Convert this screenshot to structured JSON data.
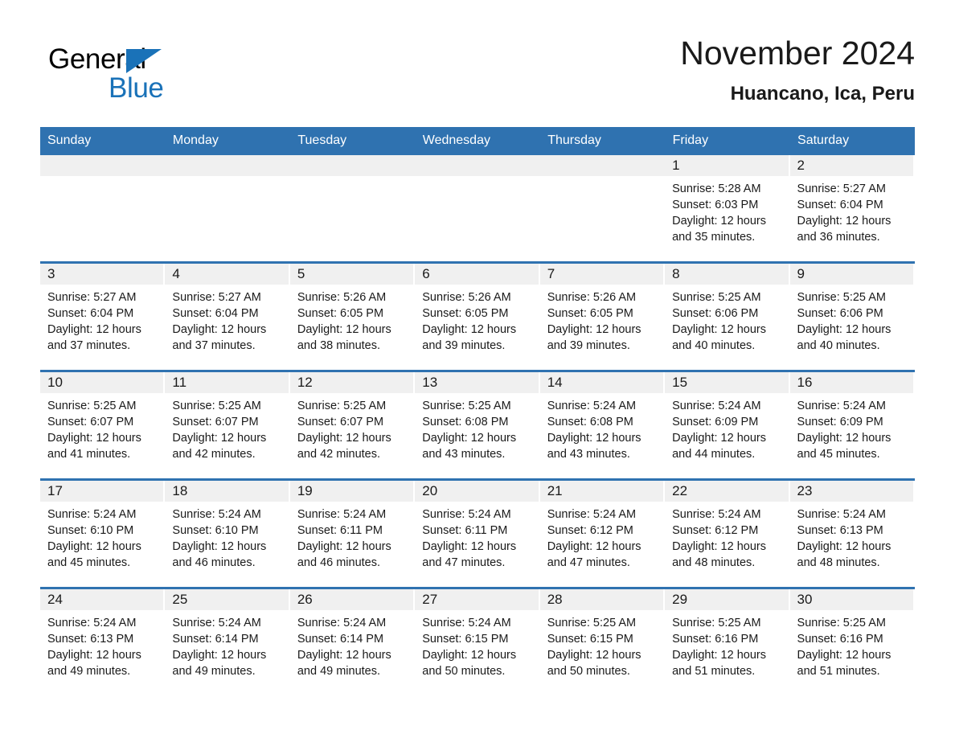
{
  "brand": {
    "name_part1": "General",
    "name_part2": "Blue",
    "accent_color": "#1a72b8"
  },
  "header": {
    "month_title": "November 2024",
    "location": "Huancano, Ica, Peru"
  },
  "theme": {
    "header_blue": "#2f72b0",
    "daynum_gray": "#f0f0f0",
    "text_color": "#1a1a1a"
  },
  "weekday_headers": [
    "Sunday",
    "Monday",
    "Tuesday",
    "Wednesday",
    "Thursday",
    "Friday",
    "Saturday"
  ],
  "labels": {
    "sunrise_prefix": "Sunrise:",
    "sunset_prefix": "Sunset:",
    "daylight_prefix": "Daylight:"
  },
  "weeks": [
    [
      {
        "day": "",
        "sunrise": "",
        "sunset": "",
        "daylight": ""
      },
      {
        "day": "",
        "sunrise": "",
        "sunset": "",
        "daylight": ""
      },
      {
        "day": "",
        "sunrise": "",
        "sunset": "",
        "daylight": ""
      },
      {
        "day": "",
        "sunrise": "",
        "sunset": "",
        "daylight": ""
      },
      {
        "day": "",
        "sunrise": "",
        "sunset": "",
        "daylight": ""
      },
      {
        "day": "1",
        "sunrise": "Sunrise: 5:28 AM",
        "sunset": "Sunset: 6:03 PM",
        "daylight": "Daylight: 12 hours and 35 minutes."
      },
      {
        "day": "2",
        "sunrise": "Sunrise: 5:27 AM",
        "sunset": "Sunset: 6:04 PM",
        "daylight": "Daylight: 12 hours and 36 minutes."
      }
    ],
    [
      {
        "day": "3",
        "sunrise": "Sunrise: 5:27 AM",
        "sunset": "Sunset: 6:04 PM",
        "daylight": "Daylight: 12 hours and 37 minutes."
      },
      {
        "day": "4",
        "sunrise": "Sunrise: 5:27 AM",
        "sunset": "Sunset: 6:04 PM",
        "daylight": "Daylight: 12 hours and 37 minutes."
      },
      {
        "day": "5",
        "sunrise": "Sunrise: 5:26 AM",
        "sunset": "Sunset: 6:05 PM",
        "daylight": "Daylight: 12 hours and 38 minutes."
      },
      {
        "day": "6",
        "sunrise": "Sunrise: 5:26 AM",
        "sunset": "Sunset: 6:05 PM",
        "daylight": "Daylight: 12 hours and 39 minutes."
      },
      {
        "day": "7",
        "sunrise": "Sunrise: 5:26 AM",
        "sunset": "Sunset: 6:05 PM",
        "daylight": "Daylight: 12 hours and 39 minutes."
      },
      {
        "day": "8",
        "sunrise": "Sunrise: 5:25 AM",
        "sunset": "Sunset: 6:06 PM",
        "daylight": "Daylight: 12 hours and 40 minutes."
      },
      {
        "day": "9",
        "sunrise": "Sunrise: 5:25 AM",
        "sunset": "Sunset: 6:06 PM",
        "daylight": "Daylight: 12 hours and 40 minutes."
      }
    ],
    [
      {
        "day": "10",
        "sunrise": "Sunrise: 5:25 AM",
        "sunset": "Sunset: 6:07 PM",
        "daylight": "Daylight: 12 hours and 41 minutes."
      },
      {
        "day": "11",
        "sunrise": "Sunrise: 5:25 AM",
        "sunset": "Sunset: 6:07 PM",
        "daylight": "Daylight: 12 hours and 42 minutes."
      },
      {
        "day": "12",
        "sunrise": "Sunrise: 5:25 AM",
        "sunset": "Sunset: 6:07 PM",
        "daylight": "Daylight: 12 hours and 42 minutes."
      },
      {
        "day": "13",
        "sunrise": "Sunrise: 5:25 AM",
        "sunset": "Sunset: 6:08 PM",
        "daylight": "Daylight: 12 hours and 43 minutes."
      },
      {
        "day": "14",
        "sunrise": "Sunrise: 5:24 AM",
        "sunset": "Sunset: 6:08 PM",
        "daylight": "Daylight: 12 hours and 43 minutes."
      },
      {
        "day": "15",
        "sunrise": "Sunrise: 5:24 AM",
        "sunset": "Sunset: 6:09 PM",
        "daylight": "Daylight: 12 hours and 44 minutes."
      },
      {
        "day": "16",
        "sunrise": "Sunrise: 5:24 AM",
        "sunset": "Sunset: 6:09 PM",
        "daylight": "Daylight: 12 hours and 45 minutes."
      }
    ],
    [
      {
        "day": "17",
        "sunrise": "Sunrise: 5:24 AM",
        "sunset": "Sunset: 6:10 PM",
        "daylight": "Daylight: 12 hours and 45 minutes."
      },
      {
        "day": "18",
        "sunrise": "Sunrise: 5:24 AM",
        "sunset": "Sunset: 6:10 PM",
        "daylight": "Daylight: 12 hours and 46 minutes."
      },
      {
        "day": "19",
        "sunrise": "Sunrise: 5:24 AM",
        "sunset": "Sunset: 6:11 PM",
        "daylight": "Daylight: 12 hours and 46 minutes."
      },
      {
        "day": "20",
        "sunrise": "Sunrise: 5:24 AM",
        "sunset": "Sunset: 6:11 PM",
        "daylight": "Daylight: 12 hours and 47 minutes."
      },
      {
        "day": "21",
        "sunrise": "Sunrise: 5:24 AM",
        "sunset": "Sunset: 6:12 PM",
        "daylight": "Daylight: 12 hours and 47 minutes."
      },
      {
        "day": "22",
        "sunrise": "Sunrise: 5:24 AM",
        "sunset": "Sunset: 6:12 PM",
        "daylight": "Daylight: 12 hours and 48 minutes."
      },
      {
        "day": "23",
        "sunrise": "Sunrise: 5:24 AM",
        "sunset": "Sunset: 6:13 PM",
        "daylight": "Daylight: 12 hours and 48 minutes."
      }
    ],
    [
      {
        "day": "24",
        "sunrise": "Sunrise: 5:24 AM",
        "sunset": "Sunset: 6:13 PM",
        "daylight": "Daylight: 12 hours and 49 minutes."
      },
      {
        "day": "25",
        "sunrise": "Sunrise: 5:24 AM",
        "sunset": "Sunset: 6:14 PM",
        "daylight": "Daylight: 12 hours and 49 minutes."
      },
      {
        "day": "26",
        "sunrise": "Sunrise: 5:24 AM",
        "sunset": "Sunset: 6:14 PM",
        "daylight": "Daylight: 12 hours and 49 minutes."
      },
      {
        "day": "27",
        "sunrise": "Sunrise: 5:24 AM",
        "sunset": "Sunset: 6:15 PM",
        "daylight": "Daylight: 12 hours and 50 minutes."
      },
      {
        "day": "28",
        "sunrise": "Sunrise: 5:25 AM",
        "sunset": "Sunset: 6:15 PM",
        "daylight": "Daylight: 12 hours and 50 minutes."
      },
      {
        "day": "29",
        "sunrise": "Sunrise: 5:25 AM",
        "sunset": "Sunset: 6:16 PM",
        "daylight": "Daylight: 12 hours and 51 minutes."
      },
      {
        "day": "30",
        "sunrise": "Sunrise: 5:25 AM",
        "sunset": "Sunset: 6:16 PM",
        "daylight": "Daylight: 12 hours and 51 minutes."
      }
    ]
  ]
}
